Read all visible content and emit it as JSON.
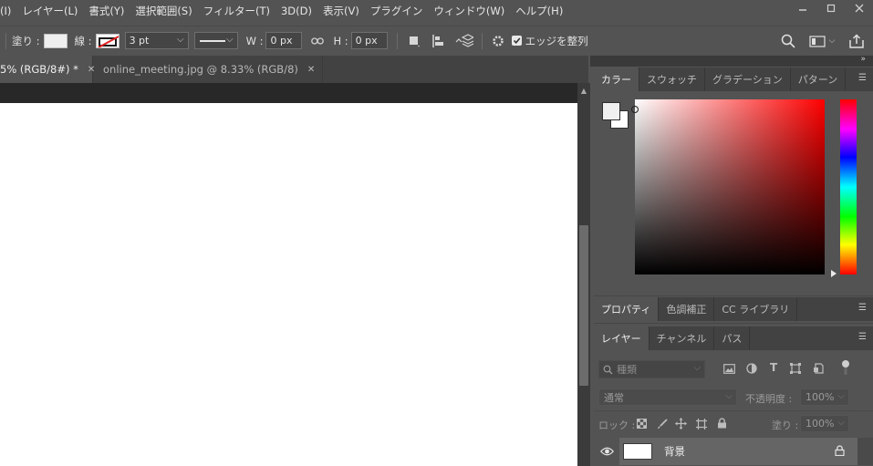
{
  "menu": {
    "items": [
      "(I)",
      "レイヤー(L)",
      "書式(Y)",
      "選択範囲(S)",
      "フィルター(T)",
      "3D(D)",
      "表示(V)",
      "プラグイン",
      "ウィンドウ(W)",
      "ヘルプ(H)"
    ]
  },
  "options": {
    "fill_label": "塗り :",
    "stroke_label": "線 :",
    "stroke_width": "3 pt",
    "w_label": "W :",
    "w_value": "0 px",
    "h_label": "H :",
    "h_value": "0 px",
    "align_edges_label": "エッジを整列",
    "align_edges_checked": true
  },
  "tabs": [
    {
      "label": "5% (RGB/8#) *",
      "active": true
    },
    {
      "label": "online_meeting.jpg @ 8.33% (RGB/8)",
      "active": false
    }
  ],
  "color_panel": {
    "tabs": [
      "カラー",
      "スウォッチ",
      "グラデーション",
      "パターン"
    ],
    "active_tab": "カラー",
    "foreground_color": "#f0f0f0",
    "background_color": "#ffffff",
    "hue_color": "#ff0000"
  },
  "properties_panel": {
    "tabs": [
      "プロパティ",
      "色調補正",
      "CC ライブラリ"
    ]
  },
  "layers_panel": {
    "tabs": [
      "レイヤー",
      "チャンネル",
      "パス"
    ],
    "filter_placeholder": "種類",
    "blend_mode": "通常",
    "opacity_label": "不透明度 :",
    "opacity_value": "100%",
    "lock_label": "ロック :",
    "fill_label": "塗り :",
    "fill_value": "100%",
    "layers": [
      {
        "name": "背景",
        "visible": true,
        "locked": true
      }
    ]
  }
}
